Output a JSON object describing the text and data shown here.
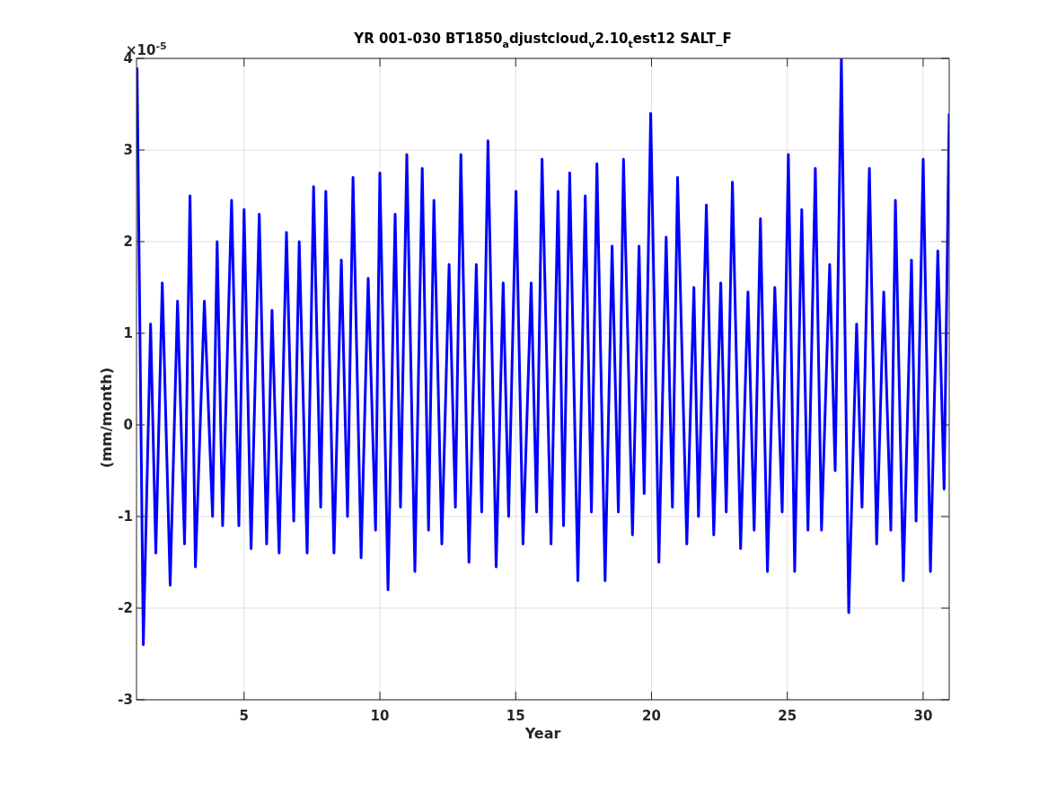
{
  "figure": {
    "exponent_label": "×10$^{-5}$",
    "chart_data": {
      "type": "line",
      "title": "YR 001-030 BT1850$_{a}$djustcloud$_{v}$2.10$_{t}$est12 SALT_F",
      "xlabel": "Year",
      "ylabel": "(mm/month)",
      "x": [
        1.06,
        1.29,
        1.56,
        1.75,
        1.99,
        2.28,
        2.55,
        2.81,
        3.01,
        3.21,
        3.54,
        3.84,
        4.01,
        4.21,
        4.54,
        4.81,
        5.0,
        5.26,
        5.56,
        5.83,
        6.03,
        6.29,
        6.56,
        6.83,
        7.03,
        7.32,
        7.56,
        7.82,
        8.01,
        8.31,
        8.58,
        8.81,
        9.01,
        9.31,
        9.57,
        9.84,
        10.0,
        10.3,
        10.56,
        10.76,
        10.99,
        11.29,
        11.56,
        11.79,
        11.99,
        12.28,
        12.55,
        12.78,
        12.98,
        13.28,
        13.55,
        13.75,
        13.98,
        14.28,
        14.54,
        14.74,
        15.01,
        15.27,
        15.57,
        15.77,
        15.97,
        16.3,
        16.56,
        16.76,
        16.99,
        17.29,
        17.56,
        17.79,
        17.99,
        18.29,
        18.55,
        18.78,
        18.97,
        19.3,
        19.54,
        19.73,
        19.97,
        20.27,
        20.54,
        20.77,
        20.96,
        21.3,
        21.56,
        21.73,
        22.02,
        22.29,
        22.55,
        22.75,
        22.98,
        23.28,
        23.55,
        23.78,
        24.01,
        24.27,
        24.54,
        24.81,
        25.04,
        25.27,
        25.53,
        25.76,
        26.03,
        26.26,
        26.56,
        26.76,
        26.99,
        27.26,
        27.55,
        27.75,
        28.02,
        28.29,
        28.55,
        28.81,
        28.98,
        29.27,
        29.57,
        29.74,
        30.0,
        30.27,
        30.54,
        30.77,
        30.96
      ],
      "series": [
        {
          "color": "#0000ff",
          "values": [
            3.9,
            -2.4,
            1.1,
            -1.4,
            1.55,
            -1.75,
            1.35,
            -1.3,
            2.5,
            -1.55,
            1.35,
            -1.0,
            2.0,
            -1.1,
            2.45,
            -1.1,
            2.35,
            -1.35,
            2.3,
            -1.3,
            1.25,
            -1.4,
            2.1,
            -1.05,
            2.0,
            -1.4,
            2.6,
            -0.9,
            2.55,
            -1.4,
            1.8,
            -1.0,
            2.7,
            -1.45,
            1.6,
            -1.15,
            2.75,
            -1.8,
            2.3,
            -0.9,
            2.95,
            -1.6,
            2.8,
            -1.15,
            2.45,
            -1.3,
            1.75,
            -0.9,
            2.95,
            -1.5,
            1.75,
            -0.95,
            3.1,
            -1.55,
            1.55,
            -1.0,
            2.55,
            -1.3,
            1.55,
            -0.95,
            2.9,
            -1.3,
            2.55,
            -1.1,
            2.75,
            -1.7,
            2.5,
            -0.95,
            2.85,
            -1.7,
            1.95,
            -0.95,
            2.9,
            -1.2,
            1.95,
            -0.75,
            3.4,
            -1.5,
            2.05,
            -0.9,
            2.7,
            -1.3,
            1.5,
            -1.0,
            2.4,
            -1.2,
            1.55,
            -0.95,
            2.65,
            -1.35,
            1.45,
            -1.15,
            2.25,
            -1.6,
            1.5,
            -0.95,
            2.95,
            -1.6,
            2.35,
            -1.15,
            2.8,
            -1.15,
            1.75,
            -0.5,
            4.0,
            -2.05,
            1.1,
            -0.9,
            2.8,
            -1.3,
            1.45,
            -1.15,
            2.45,
            -1.7,
            1.8,
            -1.05,
            2.9,
            -1.6,
            1.9,
            -0.7,
            3.4
          ]
        }
      ],
      "grid": true,
      "xlim": [
        1.04,
        30.96
      ],
      "ylim": [
        -3,
        4
      ],
      "xticks": [
        5,
        10,
        15,
        20,
        25,
        30
      ],
      "yticks": [
        -3,
        -2,
        -1,
        0,
        1,
        2,
        3,
        4
      ]
    }
  }
}
